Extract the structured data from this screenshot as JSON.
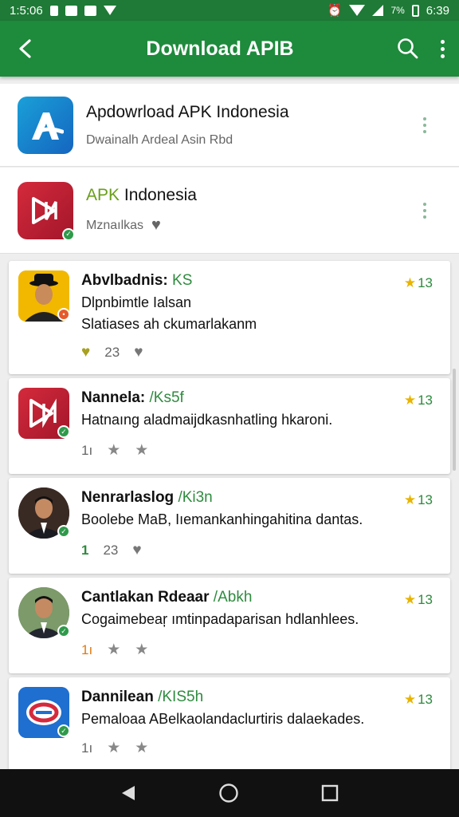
{
  "status_bar": {
    "time": "1:5:06",
    "right_time": "6:39",
    "battery": "7%"
  },
  "app_bar": {
    "title": "Download APIB"
  },
  "top_items": [
    {
      "title": "Apdowrload APK Indonesia",
      "subtitle": "Dwainalh Ardeal Asin Rbd",
      "icon": "a-logo-icon"
    },
    {
      "title_accent": "APK",
      "title_rest": " Indonesia",
      "subtitle": "Mznaılkas",
      "icon": "play-n-logo-icon"
    }
  ],
  "cards": [
    {
      "name": "Abvlbadnis:",
      "tag": "KS",
      "rating": "13",
      "desc": "Dlpnbimtle Ialsan",
      "desc2": "Slatiases ah ckumarlakanm",
      "count": "23",
      "avatar": "person-hat"
    },
    {
      "name": "Nannela:",
      "tag": "/Ks5f",
      "rating": "13",
      "desc": "Hatnaıng aladmaijdkasnhatling hkaroni.",
      "count": "1ı",
      "avatar": "play-n-logo"
    },
    {
      "name": "Nenrarlaslog",
      "tag": "/Ki3n",
      "rating": "13",
      "desc": "Boolebe MaB, Iıemankanhingahitina dantas.",
      "count": "1",
      "count2": "23",
      "avatar": "person-suit"
    },
    {
      "name": "Cantlakan Rdeaar",
      "tag": "/Abkh",
      "rating": "13",
      "desc": "Cogaimebeaŗ ımtinpadaparisan hdlanhlees.",
      "count": "1ı",
      "avatar": "person-suit-2"
    },
    {
      "name": "Dannilean",
      "tag": "/KIS5h",
      "rating": "13",
      "desc": "Pemaloaa ABelkaolandaclurtiris dalaekades.",
      "count": "1ı",
      "avatar": "blue-logo"
    }
  ],
  "colors": {
    "primary": "#1e8a3c",
    "status": "#1e7a36",
    "star": "#e8b400",
    "accent_green": "#2e8b3e"
  }
}
